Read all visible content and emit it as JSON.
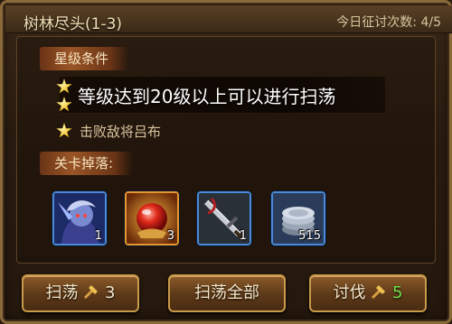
{
  "header": {
    "title": "树林尽头(1-3)",
    "daily_attempts_text": "今日征讨次数: 4/5"
  },
  "star_conditions": {
    "label": "星级条件",
    "banner_text": "等级达到20级以上可以进行扫荡",
    "condition_text": "击败敌将吕布"
  },
  "drops": {
    "label": "关卡掉落:",
    "items": [
      {
        "icon": "hero-portrait-icon",
        "quantity": "1",
        "border_color": "#4a8ad8"
      },
      {
        "icon": "red-orb-icon",
        "quantity": "3",
        "border_color": "#e6962e"
      },
      {
        "icon": "sword-icon",
        "quantity": "1",
        "border_color": "#4a8ad8"
      },
      {
        "icon": "silver-coins-icon",
        "quantity": "515",
        "border_color": "#4a8ad8"
      }
    ]
  },
  "buttons": {
    "sweep_label": "扫荡",
    "sweep_cost": "3",
    "sweep_all_label": "扫荡全部",
    "attack_label": "讨伐",
    "attack_cost": "5"
  }
}
